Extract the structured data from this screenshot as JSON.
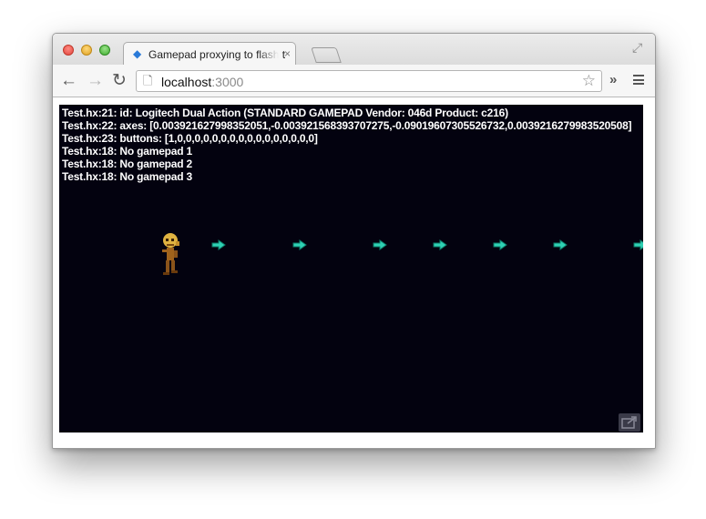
{
  "browser": {
    "tab_title": "Gamepad proxying to flash t",
    "tab_close": "×",
    "url_host": "localhost",
    "url_port": ":3000"
  },
  "icons": {
    "back": "arrow-left-icon",
    "forward": "arrow-right-icon",
    "reload": "reload-icon",
    "star": "star-icon",
    "extensions": "double-chevron-right-icon",
    "menu": "hamburger-menu-icon",
    "fullscreen": "fullscreen-icon",
    "share": "share-icon"
  },
  "colors": {
    "game_background": "#03020f",
    "arrow": "#2fd1b4",
    "player": "#b8862a",
    "log_text": "#ffffff"
  },
  "game": {
    "log_lines": [
      "Test.hx:21: id: Logitech Dual Action (STANDARD GAMEPAD Vendor: 046d Product: c216)",
      "Test.hx:22: axes: [0.003921627998352051,-0.003921568393707275,-0.09019607305526732,0.0039216279983520508]",
      "Test.hx:23: buttons: [1,0,0,0,0,0,0,0,0,0,0,0,0,0,0,0,0]",
      "Test.hx:18: No gamepad 1",
      "Test.hx:18: No gamepad 2",
      "Test.hx:18: No gamepad 3"
    ]
  }
}
